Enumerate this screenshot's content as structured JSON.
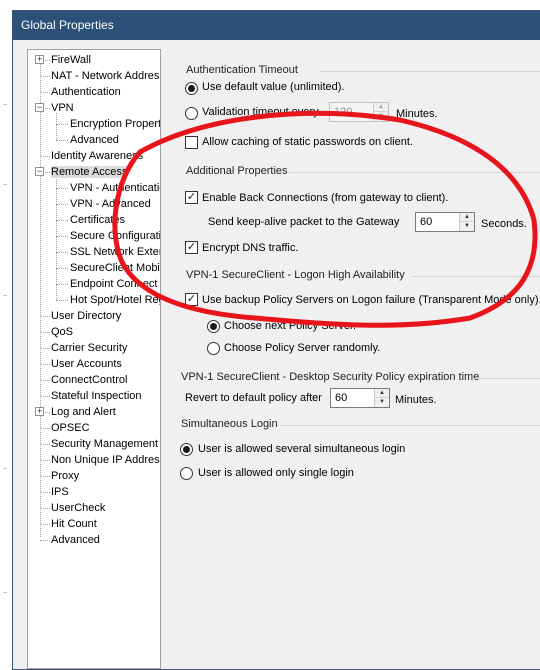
{
  "window": {
    "title": "Global Properties"
  },
  "tree": {
    "items": [
      {
        "label": "FireWall",
        "expander": "+"
      },
      {
        "label": "NAT - Network Address"
      },
      {
        "label": "Authentication"
      },
      {
        "label": "VPN",
        "expander": "−"
      },
      {
        "label": "Encryption Properties"
      },
      {
        "label": "Advanced"
      },
      {
        "label": "Identity Awareness"
      },
      {
        "label": "Remote Access",
        "expander": "−"
      },
      {
        "label": "VPN - Authentication"
      },
      {
        "label": "VPN - Advanced"
      },
      {
        "label": "Certificates"
      },
      {
        "label": "Secure Configuration"
      },
      {
        "label": "SSL Network Extender"
      },
      {
        "label": "SecureClient Mobile"
      },
      {
        "label": "Endpoint Connect"
      },
      {
        "label": "Hot Spot/Hotel Registration"
      },
      {
        "label": "User Directory"
      },
      {
        "label": "QoS"
      },
      {
        "label": "Carrier Security"
      },
      {
        "label": "User Accounts"
      },
      {
        "label": "ConnectControl"
      },
      {
        "label": "Stateful Inspection"
      },
      {
        "label": "Log and Alert",
        "expander": "+"
      },
      {
        "label": "OPSEC"
      },
      {
        "label": "Security Management Access"
      },
      {
        "label": "Non Unique IP Address"
      },
      {
        "label": "Proxy"
      },
      {
        "label": "IPS"
      },
      {
        "label": "UserCheck"
      },
      {
        "label": "Hit Count"
      },
      {
        "label": "Advanced"
      }
    ]
  },
  "auth_timeout": {
    "title": "Authentication Timeout",
    "default_label": "Use default value (unlimited).",
    "validation_label": "Validation timeout every",
    "validation_value": "120",
    "validation_unit": "Minutes.",
    "caching_label": "Allow caching of static passwords on client."
  },
  "additional": {
    "title": "Additional Properties",
    "back_conn_label": "Enable Back Connections (from gateway to client).",
    "keepalive_label": "Send keep-alive packet to the Gateway",
    "keepalive_value": "60",
    "keepalive_unit": "Seconds.",
    "dns_label": "Encrypt DNS traffic."
  },
  "high_availability": {
    "title": "VPN-1 SecureClient - Logon High Availability",
    "backup_label": "Use backup Policy Servers on Logon failure  (Transparent Mode only).",
    "next_label": "Choose next Policy Server.",
    "random_label": "Choose Policy Server randomly."
  },
  "policy_expiration": {
    "title": "VPN-1 SecureClient - Desktop Security Policy expiration time",
    "revert_label": "Revert to default policy after",
    "revert_value": "60",
    "revert_unit": "Minutes."
  },
  "simultaneous": {
    "title": "Simultaneous Login",
    "several_label": "User is allowed several simultaneous login",
    "single_label": "User is allowed only single login"
  },
  "colors": {
    "titlebar": "#2b5179",
    "annotation": "#e8141b",
    "dialog_bg": "#f0f0f0"
  }
}
